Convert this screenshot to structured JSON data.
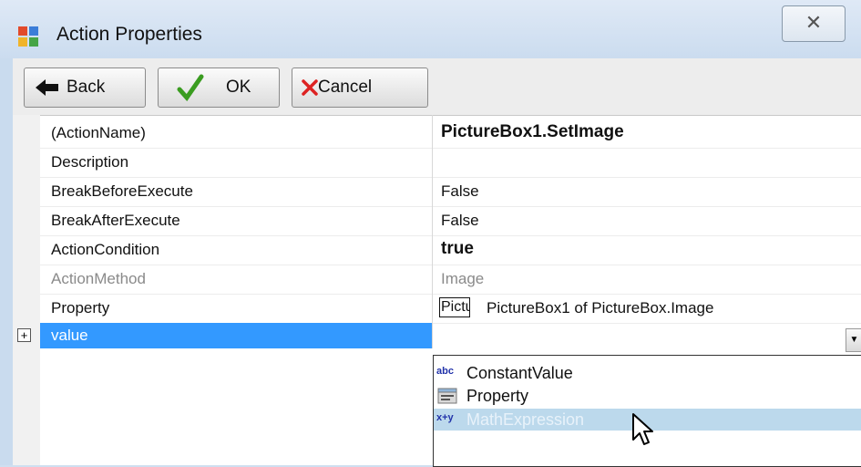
{
  "window": {
    "title": "Action Properties",
    "close_glyph": "✕"
  },
  "toolbar": {
    "back_label": "Back",
    "ok_label": "OK",
    "cancel_label": "Cancel"
  },
  "grid": {
    "expand_glyph": "+",
    "rows": [
      {
        "name": "(ActionName)",
        "value": "PictureBox1.SetImage"
      },
      {
        "name": "Description",
        "value": ""
      },
      {
        "name": "BreakBeforeExecute",
        "value": "False"
      },
      {
        "name": "BreakAfterExecute",
        "value": "False"
      },
      {
        "name": "ActionCondition",
        "value": "true"
      },
      {
        "name": "ActionMethod",
        "value": "Image"
      },
      {
        "name": "Property",
        "value_box": "Pictu",
        "value": "PictureBox1 of PictureBox.Image"
      },
      {
        "name": "value",
        "value": ""
      }
    ]
  },
  "dropdown": {
    "options": [
      {
        "icon": "abc",
        "label": "ConstantValue"
      },
      {
        "icon": "property-icon",
        "label": "Property"
      },
      {
        "icon": "x+y",
        "label": "MathExpression",
        "highlighted": true
      }
    ]
  },
  "colors": {
    "selection": "#3399ff",
    "highlight": "#bcd9ec"
  }
}
